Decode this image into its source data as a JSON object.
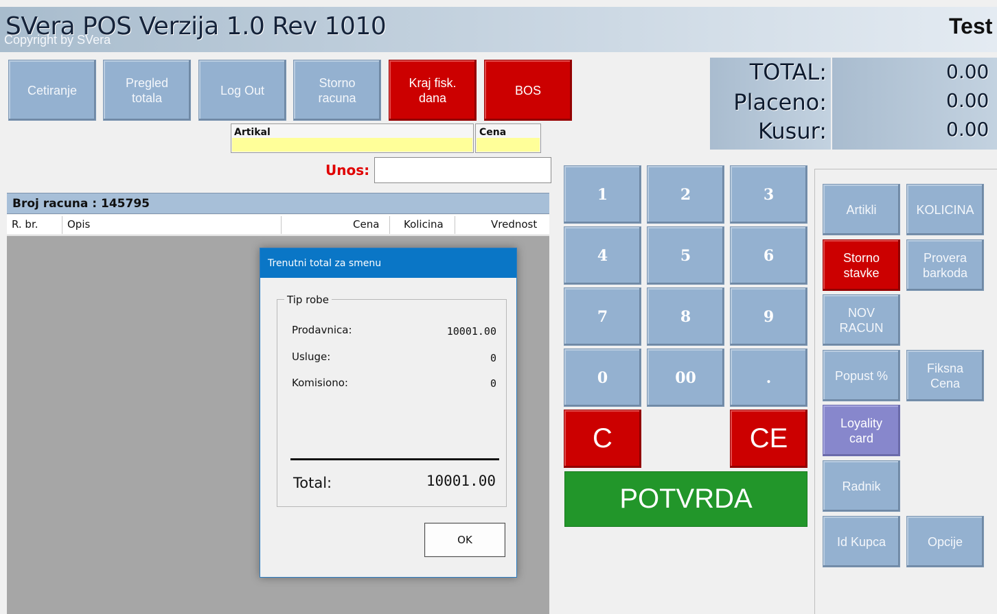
{
  "header": {
    "title": "SVera POS Verzija 1.0 Rev 1010",
    "copyright": "Copyright by SVera",
    "user": "Test"
  },
  "toolbar": {
    "cetiranje": "Cetiranje",
    "pregled_totala": "Pregled\ntotala",
    "log_out": "Log Out",
    "storno_racuna": "Storno\nracuna",
    "kraj_fisk_dana": "Kraj fisk.\ndana",
    "bos": "BOS"
  },
  "entry": {
    "artikal_label": "Artikal",
    "cena_label": "Cena",
    "unos_label": "Unos:",
    "unos_value": ""
  },
  "totals": {
    "total_label": "TOTAL:",
    "placeno_label": "Placeno:",
    "kusur_label": "Kusur:",
    "total_value": "0.00",
    "placeno_value": "0.00",
    "kusur_value": "0.00"
  },
  "receipt": {
    "title": "Broj racuna : 145795",
    "columns": [
      "R. br.",
      "Opis",
      "Cena",
      "Kolicina",
      "Vrednost"
    ],
    "rows": []
  },
  "keypad": {
    "keys": [
      "1",
      "2",
      "3",
      "4",
      "5",
      "6",
      "7",
      "8",
      "9",
      "0",
      "00",
      "."
    ],
    "clear": "C",
    "clear_entry": "CE",
    "confirm": "POTVRDA"
  },
  "functions": {
    "artikli": "Artikli",
    "kolicina": "KOLICINA",
    "storno_stavke": "Storno\nstavke",
    "provera_barkoda": "Provera\nbarkoda",
    "nov_racun": "NOV\nRACUN",
    "popust": "Popust %",
    "fiksna_cena": "Fiksna\nCena",
    "loyality_card": "Loyality\ncard",
    "radnik": "Radnik",
    "id_kupca": "Id Kupca",
    "opcije": "Opcije"
  },
  "colors": {
    "button_blue": "#94b1d0",
    "button_red": "#cc0000",
    "button_green": "#22962a",
    "button_purple": "#8787cc",
    "dialog_titlebar": "#0a76c6",
    "input_yellow": "#ffff99"
  },
  "dialog": {
    "title": "Trenutni total za smenu",
    "group_label": "Tip robe",
    "items": [
      {
        "label": "Prodavnica:",
        "value": "10001.00"
      },
      {
        "label": "Usluge:",
        "value": "0"
      },
      {
        "label": "Komisiono:",
        "value": "0"
      }
    ],
    "total_label": "Total:",
    "total_value": "10001.00",
    "ok_label": "OK"
  }
}
